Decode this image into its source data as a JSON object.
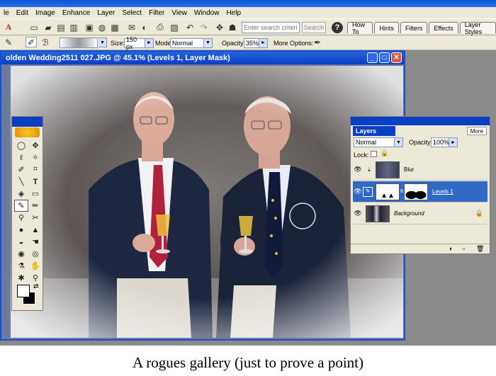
{
  "menu": [
    "le",
    "Edit",
    "Image",
    "Enhance",
    "Layer",
    "Select",
    "Filter",
    "View",
    "Window",
    "Help"
  ],
  "titlebar": {
    "title": "..."
  },
  "shortcuts": {
    "search_placeholder": "Enter search criteria",
    "search_button": "Search",
    "palette_well": [
      "How To",
      "Hints",
      "Filters",
      "Effects",
      "Layer Styles"
    ]
  },
  "options": {
    "size_label": "Size:",
    "size_value": "150 px",
    "mode_label": "Mode:",
    "mode_value": "Normal",
    "opacity_label": "Opacity:",
    "opacity_value": "35%",
    "more_options": "More Options:"
  },
  "document": {
    "title": "olden Wedding2511 027.JPG @ 45.1% (Levels 1, Layer Mask)"
  },
  "layers": {
    "tab": "Layers",
    "more": "More",
    "blend_mode": "Normal",
    "opacity_label": "Opacity:",
    "opacity_value": "100%",
    "lock_label": "Lock:",
    "items": [
      {
        "name": "Blur"
      },
      {
        "name": "Levels 1"
      },
      {
        "name": "Background"
      }
    ]
  },
  "colors": {
    "titlebar": "#0a3fc4",
    "selection": "#316ac5",
    "chrome": "#ece9d8"
  },
  "caption": "A rogues gallery (just to prove a point)"
}
